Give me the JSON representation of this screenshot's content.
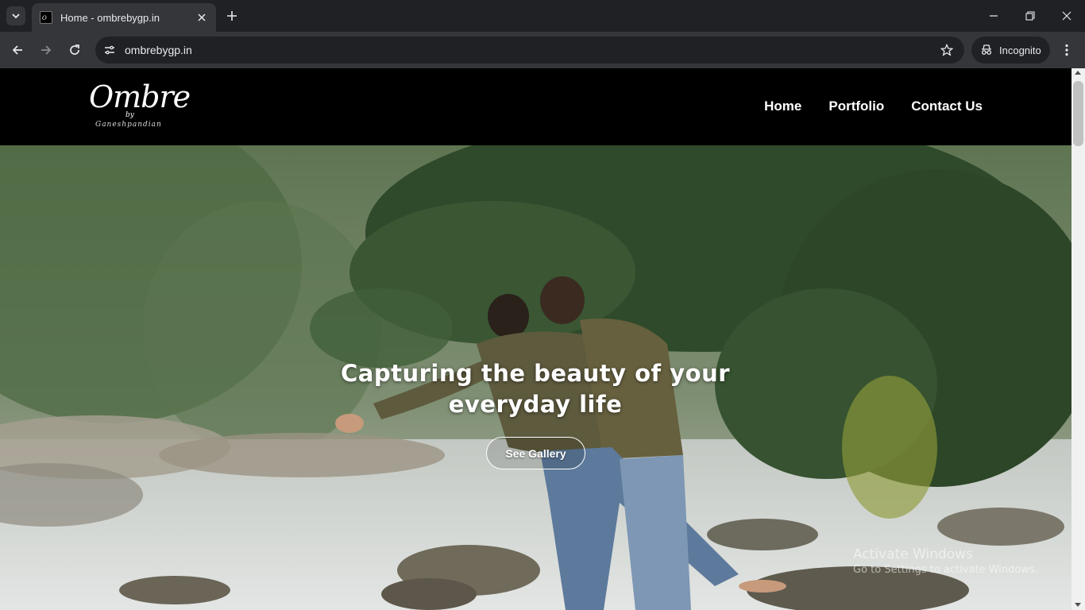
{
  "browser": {
    "tab_title": "Home - ombrebygp.in",
    "url": "ombrebygp.in",
    "incognito_label": "Incognito"
  },
  "site": {
    "logo": {
      "main": "Ombre",
      "by": "by",
      "sub": "Ganeshpandian"
    },
    "nav": [
      {
        "label": "Home"
      },
      {
        "label": "Portfolio"
      },
      {
        "label": "Contact Us"
      }
    ],
    "hero": {
      "title": "Capturing the beauty of your everyday life",
      "button": "See Gallery"
    }
  },
  "os_watermark": {
    "line1": "Activate Windows",
    "line2": "Go to Settings to activate Windows."
  },
  "colors": {
    "chrome_dark": "#202124",
    "chrome_toolbar": "#35363a",
    "header_bg": "#000000",
    "text_light": "#e8eaed"
  },
  "icons": [
    "tab-list-icon",
    "favicon-icon",
    "close-icon",
    "plus-icon",
    "minimize-icon",
    "restore-icon",
    "window-close-icon",
    "back-icon",
    "forward-icon",
    "reload-icon",
    "site-info-icon",
    "bookmark-star-icon",
    "incognito-icon",
    "kebab-menu-icon"
  ]
}
